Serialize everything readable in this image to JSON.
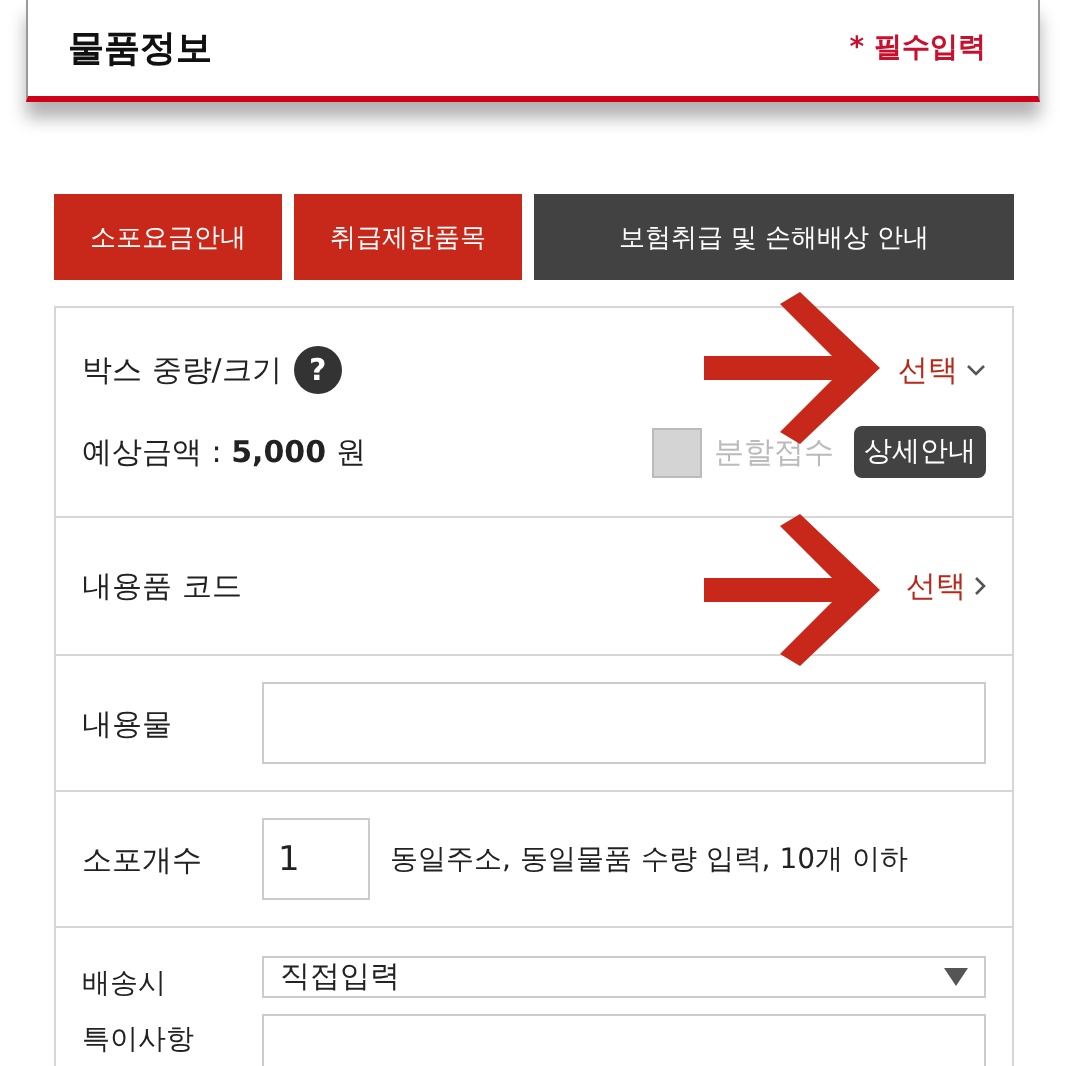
{
  "header": {
    "title": "물품정보",
    "required_note": "* 필수입력"
  },
  "guide_buttons": [
    {
      "label": "소포요금안내",
      "kind": "red"
    },
    {
      "label": "취급제한품목",
      "kind": "red"
    },
    {
      "label": "보험취급 및 손해배상 안내",
      "kind": "dark"
    }
  ],
  "box_weight": {
    "label": "박스 중량/크기",
    "help_icon": "?",
    "select": "선택",
    "estimate": "예상금액 : **5,000** 원",
    "split": {
      "label": "분할접수",
      "checked": false,
      "disabled": true
    },
    "detail_button": "상세안내"
  },
  "content_code": {
    "label": "내용품 코드",
    "select": "선택"
  },
  "contents": {
    "label": "내용물"
  },
  "parcel_count": {
    "label": "소포개수",
    "value": "1",
    "note": "동일주소, 동일물품 수량 입력, 10개 이하"
  },
  "delivery_note": {
    "label": "배송시 특이사항",
    "select": "직접입력"
  }
}
